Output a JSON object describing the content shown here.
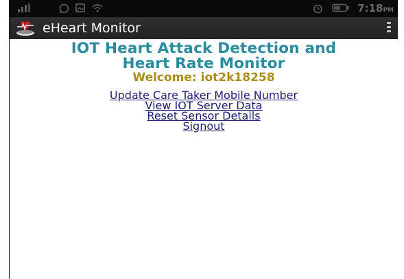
{
  "statusbar": {
    "time": "7:18",
    "ampm": "PM",
    "icons": [
      "signal-icon",
      "whatsapp-icon",
      "image-icon",
      "wifi-icon",
      "alarm-icon",
      "battery-icon"
    ]
  },
  "actionbar": {
    "title": "eHeart Monitor",
    "icon": "heart-monitor-icon",
    "menu_icon": "overflow-menu-icon"
  },
  "main": {
    "title_line1": "IOT Heart Attack Detection and",
    "title_line2": "Heart Rate Monitor",
    "welcome": "Welcome: iot2k18258",
    "links": [
      "Update Care Taker Mobile Number",
      "View IOT Server Data",
      "Reset Sensor Details",
      "Signout"
    ]
  },
  "colors": {
    "title": "#2a8c9f",
    "welcome": "#a98f19",
    "link": "#1c1c72",
    "actionbar": "#2a2a2a",
    "statusbar": "#0a0a0a"
  }
}
